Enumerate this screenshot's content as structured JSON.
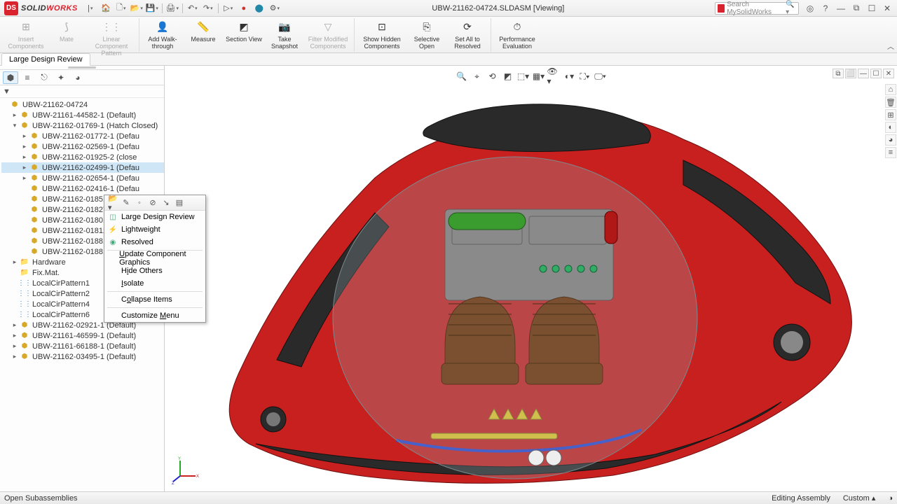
{
  "brand": {
    "solid": "SOLID",
    "works": "WORKS",
    "logo": "DS"
  },
  "title": "UBW-21162-04724.SLDASM [Viewing]",
  "search_placeholder": "Search MySolidWorks",
  "ribbon": {
    "insert": "Insert Components",
    "mate": "Mate",
    "linear": "Linear Component Pattern",
    "walk": "Add Walk-through",
    "measure": "Measure",
    "section": "Section View",
    "snapshot": "Take Snapshot",
    "filter": "Filter Modified Components",
    "show": "Show Hidden Components",
    "selective": "Selective Open",
    "resolved": "Set All to Resolved",
    "perf": "Performance Evaluation"
  },
  "active_tab": "Large Design Review",
  "tree_filter": "▼",
  "tree": {
    "root": "UBW-21162-04724",
    "items": [
      {
        "d": 1,
        "e": "▸",
        "t": "UBW-21161-44582-1 (Default)"
      },
      {
        "d": 1,
        "e": "▾",
        "t": "UBW-21162-01769-1 (Hatch Closed)"
      },
      {
        "d": 2,
        "e": "▸",
        "t": "UBW-21162-01772-1 (Defau"
      },
      {
        "d": 2,
        "e": "▸",
        "t": "UBW-21162-02569-1 (Defau"
      },
      {
        "d": 2,
        "e": "▸",
        "t": "UBW-21162-01925-2 (close"
      },
      {
        "d": 2,
        "e": "▸",
        "t": "UBW-21162-02499-1 (Defau",
        "sel": true
      },
      {
        "d": 2,
        "e": "▸",
        "t": "UBW-21162-02654-1 (Defau"
      },
      {
        "d": 2,
        "e": "",
        "t": "UBW-21162-02416-1 (Defau"
      },
      {
        "d": 2,
        "e": "",
        "t": "UBW-21162-01851-1 (Defau"
      },
      {
        "d": 2,
        "e": "",
        "t": "UBW-21162-01827-1 (Defau"
      },
      {
        "d": 2,
        "e": "",
        "t": "UBW-21162-01801-1 (Defau"
      },
      {
        "d": 2,
        "e": "",
        "t": "UBW-21162-01812-1 (Defau"
      },
      {
        "d": 2,
        "e": "",
        "t": "UBW-21162-01881-2 (Default)"
      },
      {
        "d": 2,
        "e": "",
        "t": "UBW-21162-01881-3 (Default)"
      },
      {
        "d": 1,
        "e": "▸",
        "t": "Hardware",
        "icon": "folder"
      },
      {
        "d": 1,
        "e": "",
        "t": "Fix.Mat.",
        "icon": "folder"
      },
      {
        "d": 1,
        "e": "",
        "t": "LocalCirPattern1",
        "icon": "pattern"
      },
      {
        "d": 1,
        "e": "",
        "t": "LocalCirPattern2",
        "icon": "pattern"
      },
      {
        "d": 1,
        "e": "",
        "t": "LocalCirPattern4",
        "icon": "pattern"
      },
      {
        "d": 1,
        "e": "",
        "t": "LocalCirPattern6",
        "icon": "pattern"
      },
      {
        "d": 1,
        "e": "▸",
        "t": "UBW-21162-02921-1 (Default)"
      },
      {
        "d": 1,
        "e": "▸",
        "t": "UBW-21161-46599-1 (Default)"
      },
      {
        "d": 1,
        "e": "▸",
        "t": "UBW-21161-66188-1 (Default)"
      },
      {
        "d": 1,
        "e": "▸",
        "t": "UBW-21162-03495-1 (Default)"
      }
    ]
  },
  "context_menu": {
    "ldr": "Large Design Review",
    "light": "Lightweight",
    "resolved": "Resolved",
    "update": "Update Component Graphics",
    "hide": "Hide Others",
    "isolate": "Isolate",
    "collapse": "Collapse Items",
    "customize": "Customize Menu"
  },
  "status": {
    "left": "Open Subassemblies",
    "mid": "Editing Assembly",
    "right": "Custom",
    "caret": "▴"
  }
}
